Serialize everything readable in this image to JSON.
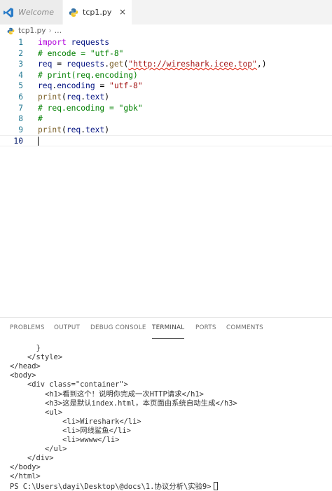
{
  "tabs": [
    {
      "label": "Welcome",
      "icon": "vscode-icon"
    },
    {
      "label": "tcp1.py",
      "icon": "python-icon",
      "close": "×"
    }
  ],
  "breadcrumb": {
    "file": "tcp1.py",
    "more": "…"
  },
  "editor": {
    "lines": [
      {
        "num": "1",
        "parts": [
          [
            "kw",
            "import"
          ],
          [
            "df",
            " "
          ],
          [
            "vr",
            "requests"
          ]
        ]
      },
      {
        "num": "2",
        "parts": [
          [
            "cm",
            "# encode = \"utf-8\""
          ]
        ]
      },
      {
        "num": "3",
        "parts": [
          [
            "vr",
            "req"
          ],
          [
            "df",
            " = "
          ],
          [
            "vr",
            "requests"
          ],
          [
            "df",
            "."
          ],
          [
            "fn",
            "get"
          ],
          [
            "df",
            "("
          ],
          [
            "st url squig",
            "\"http://wireshark.icee.top\""
          ],
          [
            "df",
            ",)"
          ]
        ]
      },
      {
        "num": "4",
        "parts": [
          [
            "cm",
            "# print(req.encoding)"
          ]
        ]
      },
      {
        "num": "5",
        "parts": [
          [
            "vr",
            "req"
          ],
          [
            "df",
            "."
          ],
          [
            "vr",
            "encoding"
          ],
          [
            "df",
            " = "
          ],
          [
            "st",
            "\"utf-8\""
          ]
        ]
      },
      {
        "num": "6",
        "parts": [
          [
            "fn",
            "print"
          ],
          [
            "df",
            "("
          ],
          [
            "vr",
            "req"
          ],
          [
            "df",
            "."
          ],
          [
            "vr",
            "text"
          ],
          [
            "df",
            ")"
          ]
        ]
      },
      {
        "num": "7",
        "parts": [
          [
            "cm",
            "# req.encoding = \"gbk\""
          ]
        ]
      },
      {
        "num": "8",
        "parts": [
          [
            "cm",
            "#"
          ]
        ]
      },
      {
        "num": "9",
        "parts": [
          [
            "fn",
            "print"
          ],
          [
            "df",
            "("
          ],
          [
            "vr",
            "req"
          ],
          [
            "df",
            "."
          ],
          [
            "vr",
            "text"
          ],
          [
            "df",
            ")"
          ]
        ]
      },
      {
        "num": "10",
        "parts": [],
        "active": true
      }
    ]
  },
  "panel": {
    "tabs": [
      "PROBLEMS",
      "OUTPUT",
      "DEBUG CONSOLE",
      "TERMINAL",
      "PORTS",
      "COMMENTS"
    ],
    "active_tab": "TERMINAL"
  },
  "terminal": {
    "lines": [
      "      }",
      "    </style>",
      "</head>",
      "<body>",
      "    <div class=\"container\">",
      "        <h1>看到这个！说明你完成一次HTTP请求</h1>",
      "        <h3>这是默认index.html，本页面由系统自动生成</h3>",
      "        <ul>",
      "            <li>Wireshark</li>",
      "            <li>网线鲨鱼</li>",
      "            <li>wwww</li>",
      "        </ul>",
      "    </div>",
      "</body>",
      "</html>",
      "PS C:\\Users\\dayi\\Desktop\\@docs\\1.协议分析\\实验9>"
    ]
  }
}
